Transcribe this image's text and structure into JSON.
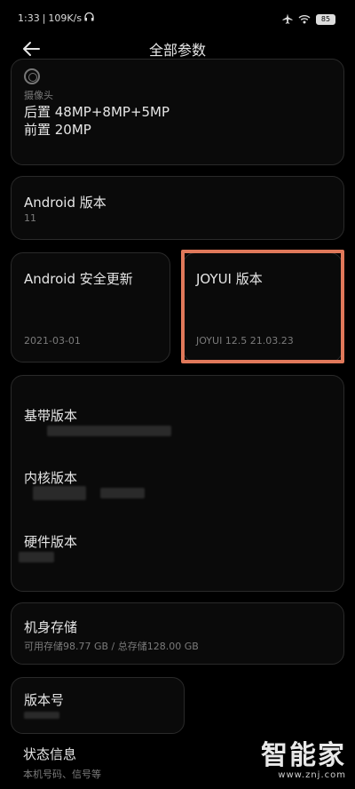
{
  "status": {
    "time": "1:33",
    "speed": "109K/s",
    "battery": "85"
  },
  "header": {
    "title": "全部参数"
  },
  "camera": {
    "label": "摄像头",
    "rear": "后置 48MP+8MP+5MP",
    "front": "前置 20MP"
  },
  "android": {
    "label": "Android 版本",
    "value": "11"
  },
  "security": {
    "label": "Android 安全更新",
    "value": "2021-03-01"
  },
  "joyui": {
    "label": "JOYUI 版本",
    "value": "JOYUI 12.5 21.03.23"
  },
  "versions": {
    "baseband": "基带版本",
    "kernel": "内核版本",
    "hardware": "硬件版本"
  },
  "storage": {
    "label": "机身存储",
    "value": "可用存储98.77 GB / 总存储128.00 GB"
  },
  "build": {
    "label": "版本号"
  },
  "statusinfo": {
    "label": "状态信息",
    "value": "本机号码、信号等"
  },
  "watermark": {
    "brand": "智能家",
    "url": "www.znj.com"
  },
  "colors": {
    "highlight": "#e0785a",
    "card_border": "#2a2a2a",
    "secondary_text": "#7b7b7b"
  },
  "icons": [
    "back-arrow-icon",
    "headphone-icon",
    "airplane-icon",
    "wifi-icon",
    "battery-icon",
    "camera-icon"
  ]
}
